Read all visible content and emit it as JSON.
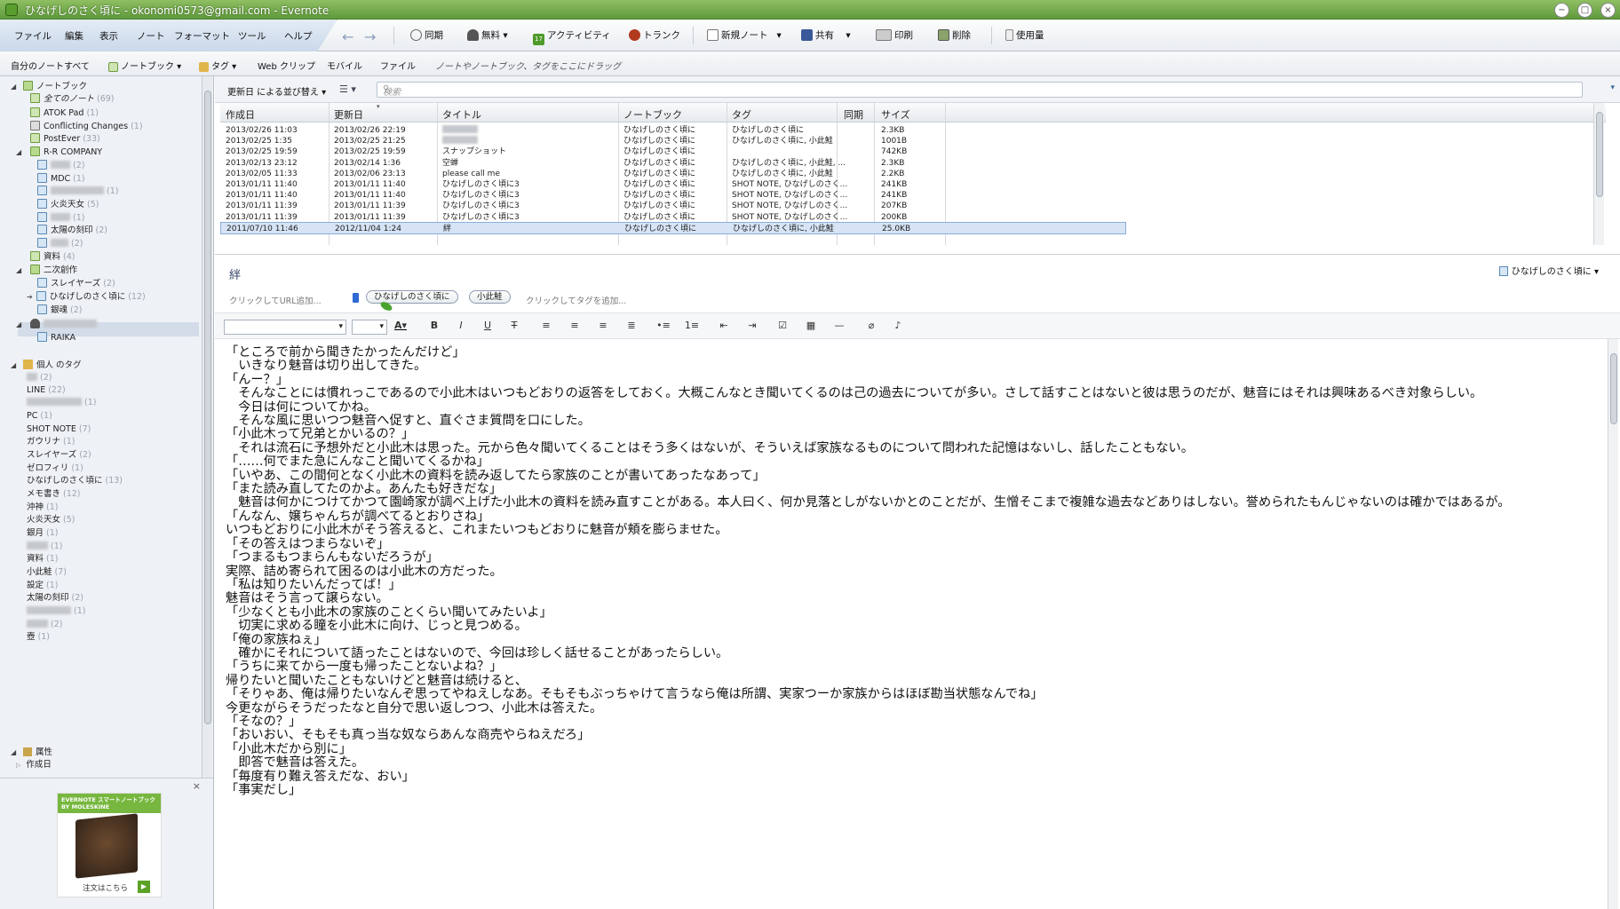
{
  "window": {
    "title": "ひなげしのさく頃に - okonomi0573@gmail.com - Evernote",
    "buttons": [
      "−",
      "□",
      "×"
    ]
  },
  "menubar": {
    "menus": [
      "ファイル",
      "編集",
      "表示",
      "ノート",
      "フォーマット",
      "ツール",
      "ヘルプ"
    ]
  },
  "toolbar": {
    "sync": "同期",
    "account": "無料",
    "activity": "アクティビティ",
    "activity_count": "17",
    "trunk": "トランク",
    "new_note": "新規ノート",
    "share": "共有",
    "print": "印刷",
    "delete": "削除",
    "usage": "使用量"
  },
  "subbar": {
    "all_notes": "自分のノートすべて",
    "notebooks": "ノートブック",
    "tags": "タグ",
    "webclip": "Web クリップ",
    "mobile": "モバイル",
    "file": "ファイル",
    "drop_hint": "ノートやノートブック、タグをここにドラッグ"
  },
  "sidebar": {
    "notebook_header": "ノートブック",
    "items": [
      {
        "label": "全てのノート",
        "count": "(69)"
      },
      {
        "label": "ATOK Pad",
        "count": "(1)"
      },
      {
        "label": "Conflicting Changes",
        "count": "(1)"
      },
      {
        "label": "PostEver",
        "count": "(33)"
      },
      {
        "label": "R-R COMPANY",
        "count": ""
      },
      {
        "label": "",
        "count": "(2)"
      },
      {
        "label": "MDC",
        "count": "(1)"
      },
      {
        "label": "",
        "count": "(1)"
      },
      {
        "label": "火炎天女",
        "count": "(5)"
      },
      {
        "label": "",
        "count": "(1)"
      },
      {
        "label": "太陽の刻印",
        "count": "(2)"
      },
      {
        "label": "",
        "count": "(2)"
      },
      {
        "label": "資料",
        "count": "(4)"
      },
      {
        "label": "二次創作",
        "count": ""
      },
      {
        "label": "スレイヤーズ",
        "count": "(2)"
      },
      {
        "label": "ひなげしのさく頃に",
        "count": "(12)"
      },
      {
        "label": "銀魂",
        "count": "(2)"
      },
      {
        "label": "",
        "count": ""
      },
      {
        "label": "RAIKA",
        "count": ""
      }
    ],
    "tags_header": "個人 のタグ",
    "tags": [
      {
        "label": "",
        "count": "(2)"
      },
      {
        "label": "LINE",
        "count": "(22)"
      },
      {
        "label": "",
        "count": "(1)"
      },
      {
        "label": "PC",
        "count": "(1)"
      },
      {
        "label": "SHOT NOTE",
        "count": "(7)"
      },
      {
        "label": "ガウリナ",
        "count": "(1)"
      },
      {
        "label": "スレイヤーズ",
        "count": "(2)"
      },
      {
        "label": "ゼロフィリ",
        "count": "(1)"
      },
      {
        "label": "ひなげしのさく頃に",
        "count": "(13)"
      },
      {
        "label": "メモ書き",
        "count": "(12)"
      },
      {
        "label": "沖神",
        "count": "(1)"
      },
      {
        "label": "火炎天女",
        "count": "(5)"
      },
      {
        "label": "銀月",
        "count": "(1)"
      },
      {
        "label": "",
        "count": "(1)"
      },
      {
        "label": "資料",
        "count": "(1)"
      },
      {
        "label": "小此鮭",
        "count": "(7)"
      },
      {
        "label": "設定",
        "count": "(1)"
      },
      {
        "label": "太陽の刻印",
        "count": "(2)"
      },
      {
        "label": "",
        "count": "(1)"
      },
      {
        "label": "",
        "count": "(2)"
      },
      {
        "label": "壺",
        "count": "(1)"
      }
    ],
    "attr_header": "属性",
    "attr_item": "作成日",
    "ad": {
      "head": "EVERNOTE スマートノートブック BY MOLESKINE",
      "text": "注文はこちら"
    }
  },
  "notelist": {
    "sort_label": "更新日 による並び替え",
    "search_placeholder": "検索",
    "columns": [
      "作成日",
      "更新日",
      "タイトル",
      "ノートブック",
      "タグ",
      "同期",
      "サイズ"
    ],
    "rows": [
      [
        "2013/02/26 11:03",
        "2013/02/26 22:19",
        "",
        "ひなげしのさく頃に",
        "ひなげしのさく頃に",
        "",
        "2.3KB"
      ],
      [
        "2013/02/25 1:35",
        "2013/02/25 21:25",
        "",
        "ひなげしのさく頃に",
        "ひなげしのさく頃に, 小此鮭",
        "",
        "1001B"
      ],
      [
        "2013/02/25 19:59",
        "2013/02/25 19:59",
        "スナップショット",
        "ひなげしのさく頃に",
        "",
        "",
        "742KB"
      ],
      [
        "2013/02/13 23:12",
        "2013/02/14 1:36",
        "空蝉",
        "ひなげしのさく頃に",
        "ひなげしのさく頃に, 小此鮭, ...",
        "",
        "2.3KB"
      ],
      [
        "2013/02/05 11:33",
        "2013/02/06 23:13",
        "please call me",
        "ひなげしのさく頃に",
        "ひなげしのさく頃に, 小此鮭",
        "",
        "2.2KB"
      ],
      [
        "2013/01/11 11:40",
        "2013/01/11 11:40",
        "ひなげしのさく頃に3",
        "ひなげしのさく頃に",
        "SHOT NOTE, ひなげしのさく...",
        "",
        "241KB"
      ],
      [
        "2013/01/11 11:40",
        "2013/01/11 11:40",
        "ひなげしのさく頃に3",
        "ひなげしのさく頃に",
        "SHOT NOTE, ひなげしのさく...",
        "",
        "241KB"
      ],
      [
        "2013/01/11 11:39",
        "2013/01/11 11:39",
        "ひなげしのさく頃に3",
        "ひなげしのさく頃に",
        "SHOT NOTE, ひなげしのさく...",
        "",
        "207KB"
      ],
      [
        "2013/01/11 11:39",
        "2013/01/11 11:39",
        "ひなげしのさく頃に3",
        "ひなげしのさく頃に",
        "SHOT NOTE, ひなげしのさく...",
        "",
        "200KB"
      ],
      [
        "2011/07/10 11:46",
        "2012/11/04 1:24",
        "絆",
        "ひなげしのさく頃に",
        "ひなげしのさく頃に, 小此鮭",
        "",
        "25.0KB"
      ]
    ]
  },
  "note": {
    "title": "絆",
    "notebook": "ひなげしのさく頃に",
    "url_hint": "クリックしてURL追加...",
    "tags": [
      "ひなげしのさく頃に",
      "小此鮭"
    ],
    "tag_hint": "クリックしてタグを追加...",
    "body": "「ところで前から聞きたかったんだけど」\n　いきなり魅音は切り出してきた。\n「んー？」\n　そんなことには慣れっこであるので小此木はいつもどおりの返答をしておく。大概こんなとき聞いてくるのは己の過去についてが多い。さして話すことはないと彼は思うのだが、魅音にはそれは興味あるべき対象らしい。\n　今日は何についてかね。\n　そんな風に思いつつ魅音へ促すと、直ぐさま質問を口にした。\n「小此木って兄弟とかいるの？」\n　それは流石に予想外だと小此木は思った。元から色々聞いてくることはそう多くはないが、そういえば家族なるものについて問われた記憶はないし、話したこともない。\n「……何でまた急にんなこと聞いてくるかね」\n「いやあ、この間何となく小此木の資料を読み返してたら家族のことが書いてあったなあって」\n「また読み直してたのかよ。あんたも好きだな」\n　魅音は何かにつけてかつて園崎家が調べ上げた小此木の資料を読み直すことがある。本人曰く、何か見落としがないかとのことだが、生憎そこまで複雑な過去などありはしない。誉められたもんじゃないのは確かではあるが。\n「んなん、嬢ちゃんちが調べてるとおりさね」\nいつもどおりに小此木がそう答えると、これまたいつもどおりに魅音が頬を膨らませた。\n「その答えはつまらないぞ」\n「つまるもつまらんもないだろうが」\n実際、詰め寄られて困るのは小此木の方だった。\n「私は知りたいんだってば！」\n魅音はそう言って譲らない。\n「少なくとも小此木の家族のことくらい聞いてみたいよ」\n　切実に求める瞳を小此木に向け、じっと見つめる。\n「俺の家族ねぇ」\n　確かにそれについて語ったことはないので、今回は珍しく話せることがあったらしい。\n「うちに来てから一度も帰ったことないよね？」\n帰りたいと聞いたこともないけどと魅音は続けると、\n「そりゃあ、俺は帰りたいなんぞ思ってやねえしなあ。そもそもぶっちゃけて言うなら俺は所謂、実家つーか家族からはほぼ勘当状態なんでね」\n今更ながらそうだったなと自分で思い返しつつ、小此木は答えた。\n「そなの？」\n「おいおい、そもそも真っ当な奴ならあんな商売やらねえだろ」\n「小此木だから別に」\n　即答で魅音は答えた。\n「毎度有り難え答えだな、おい」\n「事実だし」"
  }
}
